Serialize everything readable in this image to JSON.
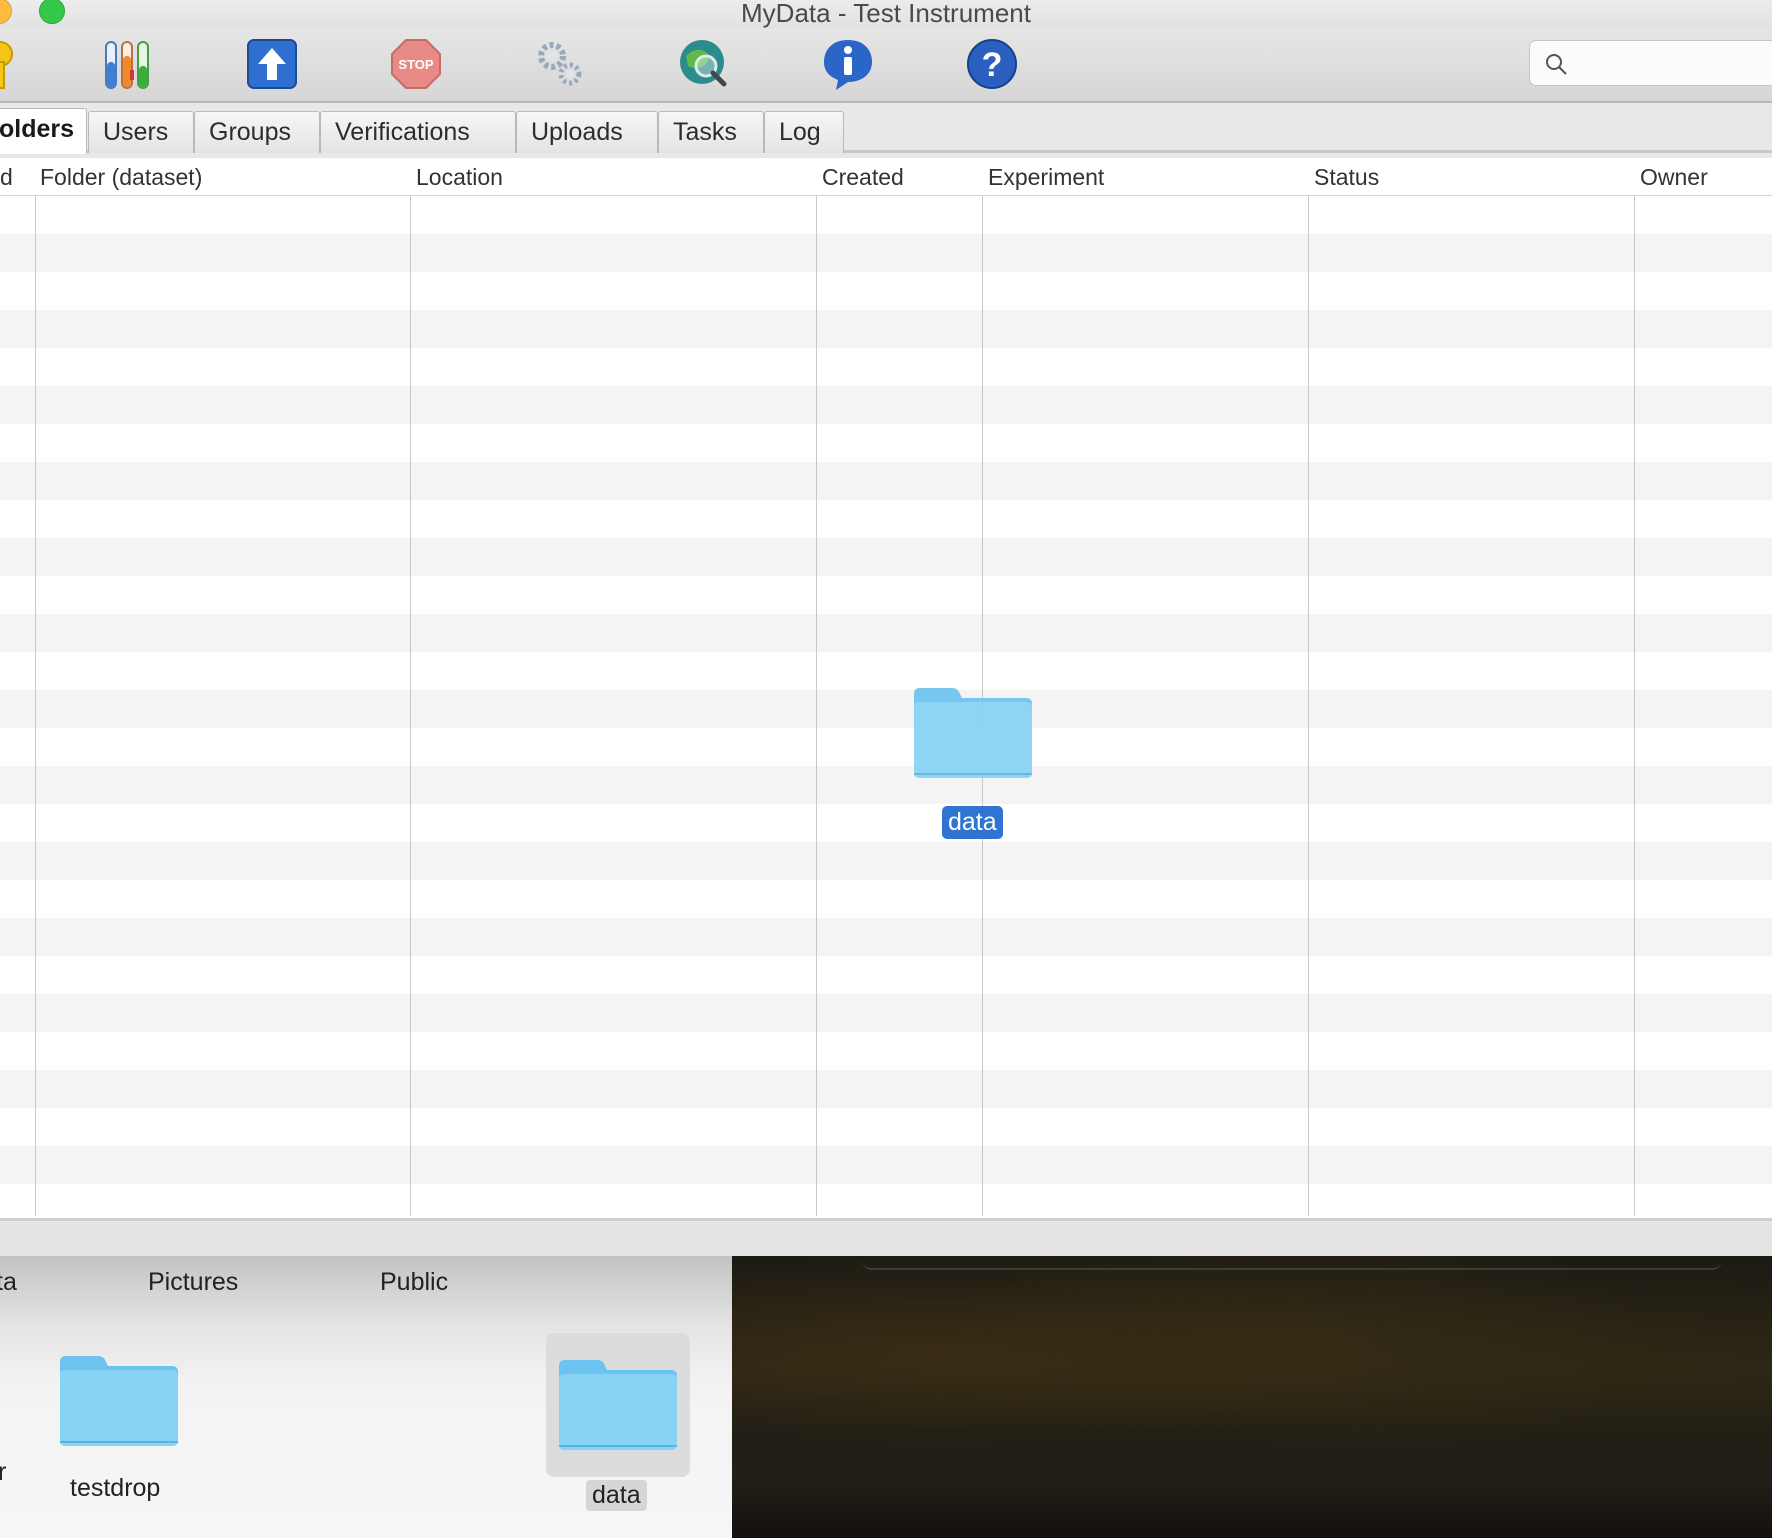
{
  "window": {
    "title": "MyData - Test Instrument"
  },
  "toolbar": {
    "icons": [
      "key-icon",
      "test-tubes-icon",
      "upload-arrow-icon",
      "stop-icon",
      "settings-gears-icon",
      "globe-search-icon",
      "info-icon",
      "help-icon"
    ],
    "search": {
      "value": "",
      "placeholder": ""
    }
  },
  "tabs": [
    "olders",
    "Users",
    "Groups",
    "Verifications",
    "Uploads",
    "Tasks",
    "Log"
  ],
  "active_tab": "olders",
  "table": {
    "columns": [
      "d",
      "Folder (dataset)",
      "Location",
      "Created",
      "Experiment",
      "Status",
      "Owner"
    ],
    "rows": []
  },
  "drag": {
    "label": "data"
  },
  "finder": {
    "headers": [
      "ta",
      "Pictures",
      "Public"
    ],
    "items": [
      {
        "name": "r"
      },
      {
        "name": "testdrop"
      },
      {
        "name": "data"
      }
    ]
  },
  "colors": {
    "folder_blue": "#7fcff5",
    "selection_blue": "#2f74d0",
    "stripe": "#f4f4f4"
  }
}
